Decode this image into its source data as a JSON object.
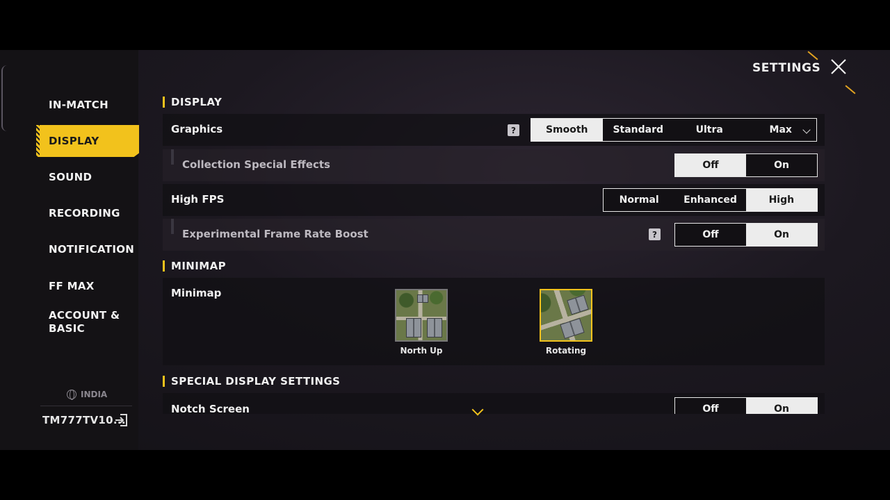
{
  "header": {
    "title": "SETTINGS"
  },
  "sidebar": {
    "items": [
      {
        "label": "IN-MATCH"
      },
      {
        "label": "DISPLAY"
      },
      {
        "label": "SOUND"
      },
      {
        "label": "RECORDING"
      },
      {
        "label": "NOTIFICATION"
      },
      {
        "label": "FF MAX"
      },
      {
        "label": "ACCOUNT &\nBASIC",
        "line1": "ACCOUNT &",
        "line2": "BASIC"
      }
    ],
    "active_item": "DISPLAY",
    "region": "INDIA",
    "user_id": "TM777TV10..."
  },
  "sections": {
    "display": {
      "title": "DISPLAY",
      "graphics": {
        "label": "Graphics",
        "help": "?",
        "options": [
          "Smooth",
          "Standard",
          "Ultra",
          "Max"
        ],
        "selected": "Smooth"
      },
      "collection_effects": {
        "label": "Collection Special Effects",
        "options": [
          "Off",
          "On"
        ],
        "selected": "Off"
      },
      "high_fps": {
        "label": "High FPS",
        "options": [
          "Normal",
          "Enhanced",
          "High"
        ],
        "selected": "High"
      },
      "frame_boost": {
        "label": "Experimental Frame Rate Boost",
        "help": "?",
        "options": [
          "Off",
          "On"
        ],
        "selected": "On"
      }
    },
    "minimap": {
      "title": "MINIMAP",
      "label": "Minimap",
      "options": [
        {
          "label": "North Up"
        },
        {
          "label": "Rotating"
        }
      ],
      "selected": "Rotating"
    },
    "special": {
      "title": "SPECIAL DISPLAY SETTINGS",
      "notch": {
        "label": "Notch Screen",
        "options": [
          "Off",
          "On"
        ],
        "selected": "On"
      }
    }
  },
  "colors": {
    "accent": "#f2c21c",
    "background": "#1c1820",
    "selected_option": "#ececec"
  }
}
